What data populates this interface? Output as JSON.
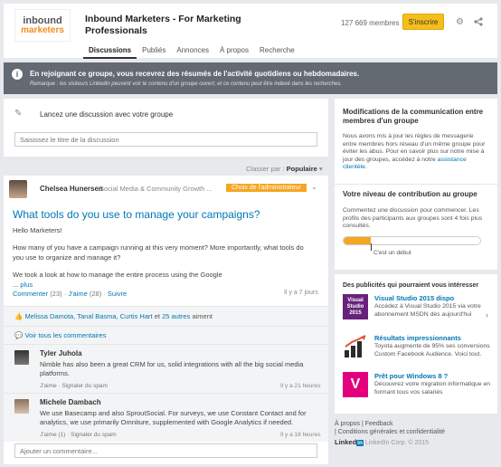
{
  "group": {
    "logo_line1": "inbound",
    "logo_line2": "marketers",
    "title": "Inbound Marketers - For Marketing Professionals",
    "members": "127 669 membres",
    "join_label": "S'inscrire"
  },
  "tabs": [
    {
      "label": "Discussions"
    },
    {
      "label": "Publiés"
    },
    {
      "label": "Annonces"
    },
    {
      "label": "À propos"
    },
    {
      "label": "Recherche"
    }
  ],
  "banner": {
    "main": "En rejoignant ce groupe, vous recevrez des résumés de l'activité quotidiens ou hebdomadaires.",
    "note": "Remarque : les visiteurs LinkedIn peuvent voir le contenu d'un groupe ouvert, et ce contenu peut être indexé dans les recherches."
  },
  "start": {
    "label": "Lancez une discussion avec votre groupe",
    "placeholder": "Saisissez le titre de la discussion"
  },
  "sort": {
    "label": "Classer par :",
    "value": "Populaire"
  },
  "post": {
    "author": "Chelsea Hunersen",
    "role": "Social Media & Community Growth ...",
    "badge": "Choix de l'administrateur",
    "title": "What tools do you use to manage your campaigns?",
    "p1": "Hello Marketers!",
    "p2": "How many of you have a campaign running at this very moment? More importantly, what tools do you use to organize and manage it?",
    "p3": "We took a look at how to manage the entire process using the Google",
    "ellipsis": "...",
    "more": "plus",
    "comment_label": "Commenter",
    "comment_count": "(23)",
    "like_label": "J'aime",
    "like_count": "(28)",
    "follow_label": "Suivre",
    "ago": "Il y a 7 jours",
    "likers": "Melissa Damota, Tanal Basma, Curtis Hart",
    "likers_and": "et",
    "likers_others": "25 autres",
    "likers_suffix": "aiment",
    "see_all": "Voir tous les commentaires"
  },
  "comments": [
    {
      "name": "Tyler Juhola",
      "text": "Nimble has also been a great CRM for us, solid integrations with all the big social media platforms.",
      "like": "J'aime",
      "report": "Signaler du spam",
      "ago": "Il y a 21 heures"
    },
    {
      "name": "Michele Dambach",
      "text": "We use Basecamp and also SproutSocial. For surveys, we use Constant Contact and for analytics, we use primarily Omniture, supplemented with Google Analytics if needed.",
      "like": "J'aime (1)",
      "report": "Signaler du spam",
      "ago": "Il y a 18 heures"
    }
  ],
  "add_comment_placeholder": "Ajouter un commentaire...",
  "right": {
    "policy_title": "Modifications de la communication entre membres d'un groupe",
    "policy_text": "Nous avons mis à jour les règles de messagerie entre membres hors réseau d'un même groupe pour éviter les abus. Pour en savoir plus sur notre mise à jour des groupes, accédez à notre",
    "policy_link": "assistance clientèle.",
    "contrib_title": "Votre niveau de contribution au groupe",
    "contrib_text": "Commentez une discussion pour commencer. Les profils des participants aux groupes sont 4 fois plus consultés.",
    "contrib_level_label": "C'est un début",
    "contrib_progress": 0.2,
    "ads_title": "Des publicités qui pourraient vous intéresser",
    "ads": [
      {
        "icon": "visual-studio-icon",
        "icon_text": "Visual Studio 2015",
        "title": "Visual Studio 2015 dispo",
        "text": "Accédez à Visual Studio 2015 via votre abonnement MSDN dès aujourd'hui"
      },
      {
        "icon": "chart-icon",
        "title": "Résultats impressionnants",
        "text": "Toyota augmente de 95% ses conversions Custom Facebook Audience. Voici tout."
      },
      {
        "icon": "v-logo-icon",
        "icon_text": "V",
        "title": "Prêt pour Windows 8 ?",
        "text": "Découvrez votre migration informatique en formant tous vos salariés"
      }
    ]
  },
  "footer": {
    "about": "À propos",
    "feedback": "Feedback",
    "terms": "Conditions générales et confidentialité",
    "brand": "Linked",
    "brand_in": "in",
    "copyright": "LinkedIn Corp. © 2015"
  },
  "colors": {
    "accent": "#0077b5",
    "join": "#f5be1b",
    "badge": "#f5a623",
    "banner": "#636a72"
  }
}
